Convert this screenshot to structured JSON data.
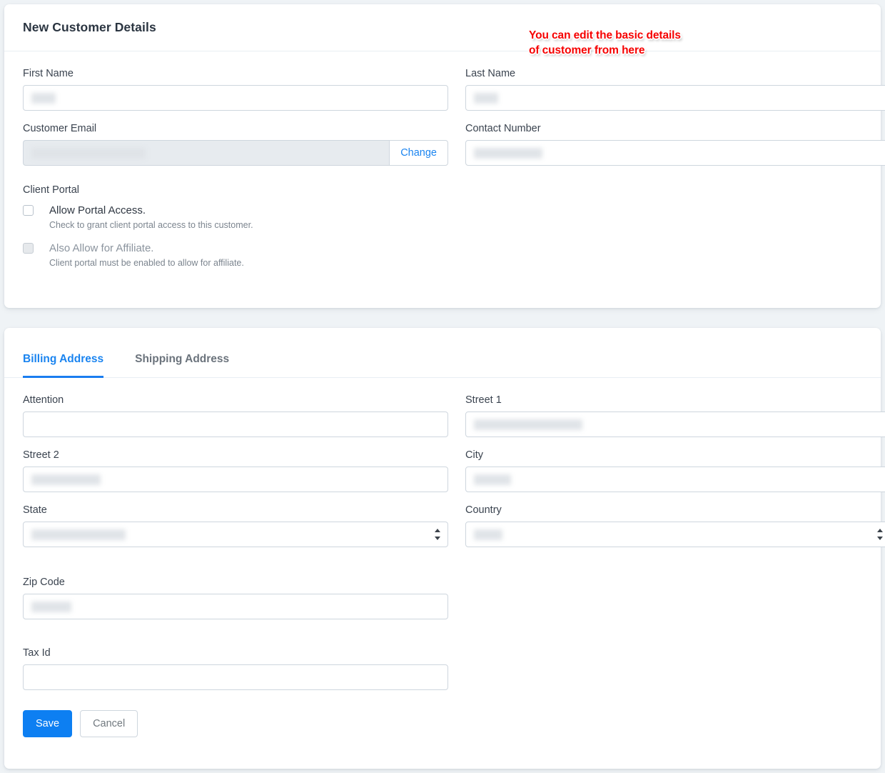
{
  "annotation": {
    "text": "You can edit the basic details of customer from here",
    "color": "#f60000"
  },
  "details_card": {
    "title": "New Customer Details",
    "fields": {
      "first_name": {
        "label": "First Name",
        "value": "",
        "redacted": true,
        "redact_width": 34
      },
      "last_name": {
        "label": "Last Name",
        "value": "",
        "redacted": true,
        "redact_width": 34
      },
      "customer_email": {
        "label": "Customer Email",
        "value": "",
        "redacted": true,
        "redact_width": 160,
        "readonly": true,
        "change_label": "Change"
      },
      "contact_number": {
        "label": "Contact Number",
        "value": "",
        "redacted": true,
        "redact_width": 96
      }
    },
    "client_portal": {
      "heading": "Client Portal",
      "options": [
        {
          "label": "Allow Portal Access.",
          "help": "Check to grant client portal access to this customer.",
          "checked": false,
          "disabled": false
        },
        {
          "label": "Also Allow for Affiliate.",
          "help": "Client portal must be enabled to allow for affiliate.",
          "checked": false,
          "disabled": true
        }
      ]
    }
  },
  "address_card": {
    "tabs": [
      {
        "label": "Billing Address",
        "active": true
      },
      {
        "label": "Shipping Address",
        "active": false
      }
    ],
    "fields": {
      "attention": {
        "label": "Attention",
        "value": "",
        "redacted": false,
        "redact_width": 0
      },
      "street1": {
        "label": "Street 1",
        "value": "",
        "redacted": true,
        "redact_width": 152
      },
      "street2": {
        "label": "Street 2",
        "value": "",
        "redacted": true,
        "redact_width": 97
      },
      "city": {
        "label": "City",
        "value": "",
        "redacted": true,
        "redact_width": 52
      },
      "state": {
        "label": "State",
        "value": "",
        "redacted": true,
        "redact_width": 132,
        "type": "select"
      },
      "country": {
        "label": "Country",
        "value": "",
        "redacted": true,
        "redact_width": 40,
        "type": "select"
      },
      "zip_code": {
        "label": "Zip Code",
        "value": "",
        "redacted": true,
        "redact_width": 56
      },
      "tax_id": {
        "label": "Tax Id",
        "value": "",
        "redacted": false,
        "redact_width": 0
      }
    },
    "actions": {
      "save_label": "Save",
      "cancel_label": "Cancel"
    }
  }
}
